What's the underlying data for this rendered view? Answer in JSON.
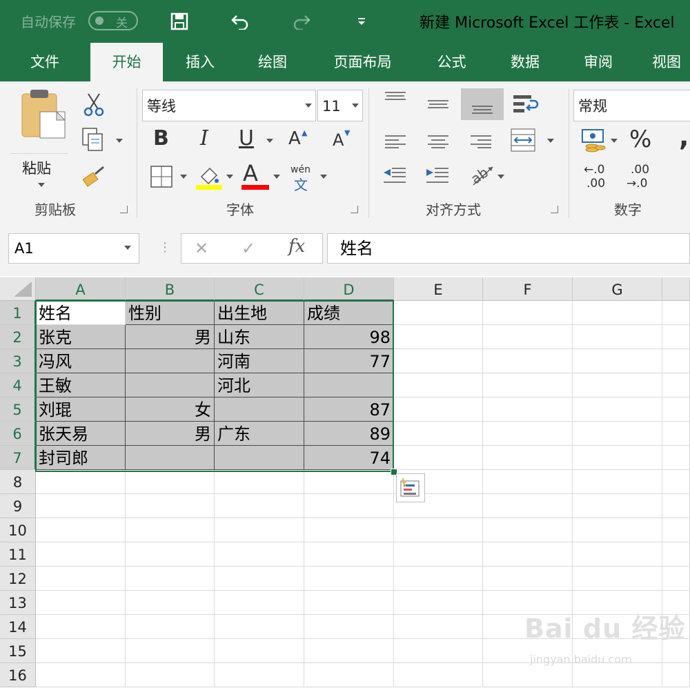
{
  "titlebar": {
    "autosave_label": "自动保存",
    "autosave_state": "关",
    "title": "新建 Microsoft Excel 工作表  -  Excel"
  },
  "tabs": [
    "文件",
    "开始",
    "插入",
    "绘图",
    "页面布局",
    "公式",
    "数据",
    "审阅",
    "视图"
  ],
  "active_tab": "开始",
  "ribbon": {
    "clipboard": {
      "paste_label": "粘贴",
      "group_label": "剪贴板"
    },
    "font": {
      "font_name": "等线",
      "font_size": "11",
      "group_label": "字体",
      "bold": "B",
      "italic": "I",
      "underline": "U",
      "grow": "A",
      "shrink": "A",
      "font_color_letter": "A",
      "phonetic_top": "wén",
      "phonetic_bottom": "文",
      "fill_color": "#ffff00",
      "font_color": "#ff0000"
    },
    "alignment": {
      "group_label": "对齐方式"
    },
    "number": {
      "format": "常规",
      "percent": "%",
      "comma": ",",
      "group_label": "数字",
      "inc_decimal_top": "←.0",
      "inc_decimal_bottom": ".00",
      "dec_decimal_top": ".00",
      "dec_decimal_bottom": "→.0"
    }
  },
  "formula_bar": {
    "name_box": "A1",
    "fx": "fx",
    "content": "姓名"
  },
  "columns": [
    "A",
    "B",
    "C",
    "D",
    "E",
    "F",
    "G"
  ],
  "rows": [
    "1",
    "2",
    "3",
    "4",
    "5",
    "6",
    "7",
    "8",
    "9",
    "10",
    "11",
    "12",
    "13",
    "14",
    "15",
    "16"
  ],
  "sheet": [
    [
      "姓名",
      "性别",
      "出生地",
      "成绩"
    ],
    [
      "张克",
      "男",
      "山东",
      "98"
    ],
    [
      "冯风",
      "",
      "河南",
      "77"
    ],
    [
      "王敏",
      "",
      "河北",
      ""
    ],
    [
      "刘琨",
      "女",
      "",
      "87"
    ],
    [
      "张天易",
      "男",
      "广东",
      "89"
    ],
    [
      "封司郎",
      "",
      "",
      "74"
    ]
  ],
  "watermark": {
    "main": "Bai du 经验",
    "sub": "jingyan.baidu.com"
  },
  "colors": {
    "excel_green": "#217346",
    "selection_fill": "#c8c8c8"
  }
}
